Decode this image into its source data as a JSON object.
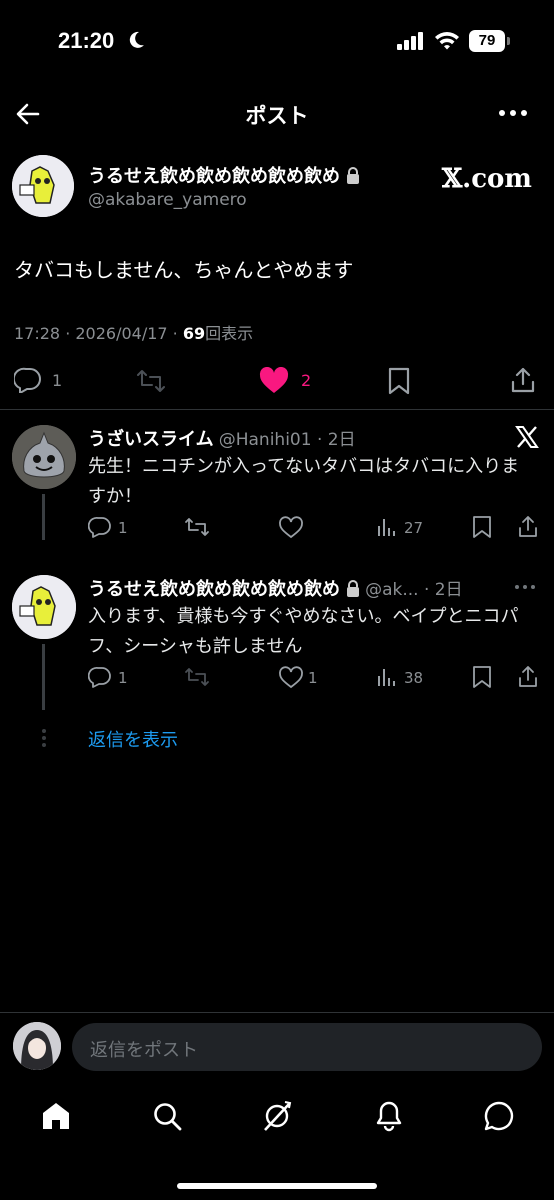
{
  "status_bar": {
    "time": "21:20",
    "battery": "79"
  },
  "header": {
    "title": "ポスト"
  },
  "post": {
    "author_name": "うるせえ飲め飲め飲め飲め飲め",
    "author_handle": "@akabare_yamero",
    "overlay_text": "𝕏.com",
    "text": "タバコもしません、ちゃんとやめます",
    "timestamp": "17:28 · 2026/04/17 · ",
    "views": "69",
    "views_label": "回表示",
    "reply_count": "1",
    "like_count": "2",
    "like_color": "#f91880"
  },
  "replies": [
    {
      "name": "うざいスライム",
      "handle": "@Hanihi01 · 2日",
      "text": "先生！ニコチンが入ってないタバコはタバコに入りますか！",
      "reply_count": "1",
      "like_count": "",
      "views": "27"
    },
    {
      "name": "うるせえ飲め飲め飲め飲め飲め",
      "handle": "@ak... · 2日",
      "text": "入ります、貴様も今すぐやめなさい。ベイプとニコパフ、シーシャも許しません",
      "reply_count": "1",
      "like_count": "1",
      "views": "38"
    }
  ],
  "show_replies": "返信を表示",
  "composer": {
    "placeholder": "返信をポスト"
  },
  "accent_color": "#1d9bf0"
}
